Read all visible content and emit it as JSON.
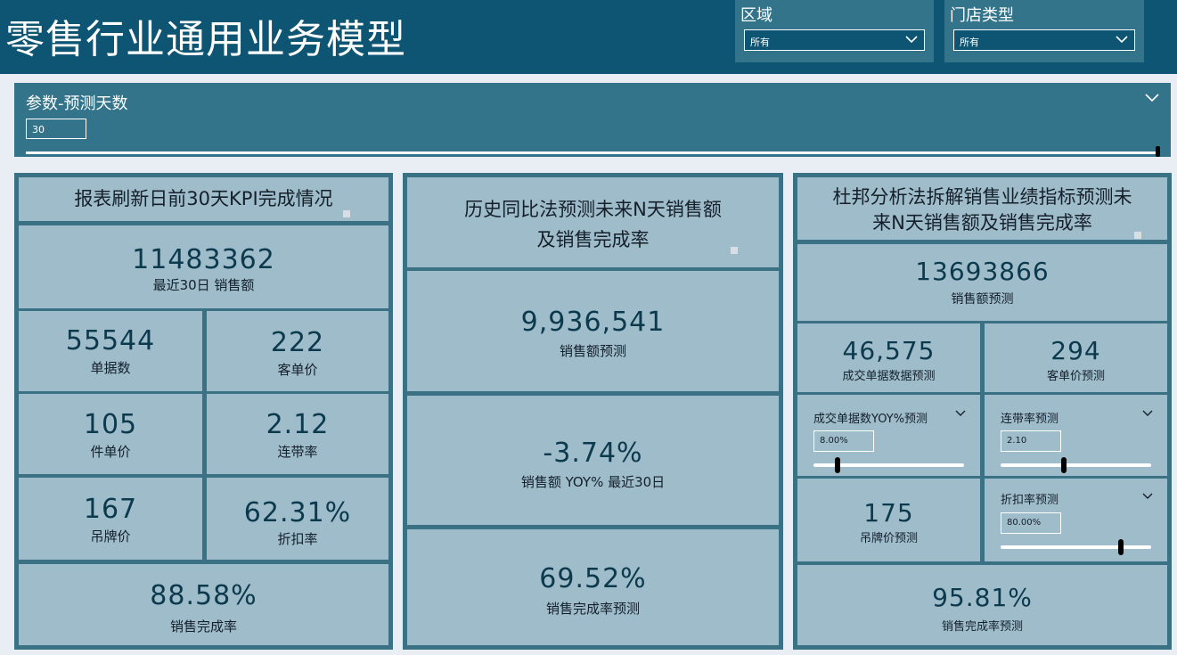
{
  "header": {
    "title": "零售行业通用业务模型",
    "region": {
      "label": "区域",
      "value": "所有"
    },
    "store_type": {
      "label": "门店类型",
      "value": "所有"
    }
  },
  "parameter": {
    "label": "参数-预测天数",
    "value": "30",
    "slider_fraction": 1.0
  },
  "left_panel": {
    "title": "报表刷新日前30天KPI完成情况",
    "sales": {
      "value": "11483362",
      "label": "最近30日 销售额"
    },
    "orders": {
      "value": "55544",
      "label": "单据数"
    },
    "avg_order": {
      "value": "222",
      "label": "客单价"
    },
    "unit_price": {
      "value": "105",
      "label": "件单价"
    },
    "attach_rate": {
      "value": "2.12",
      "label": "连带率"
    },
    "tag_price": {
      "value": "167",
      "label": "吊牌价"
    },
    "discount": {
      "value": "62.31%",
      "label": "折扣率"
    },
    "completion": {
      "value": "88.58%",
      "label": "销售完成率"
    }
  },
  "middle_panel": {
    "title_line1": "历史同比法预测未来N天销售额",
    "title_line2": "及销售完成率",
    "forecast_sales": {
      "value": "9,936,541",
      "label": "销售额预测"
    },
    "yoy": {
      "value": "-3.74%",
      "label": "销售额 YOY% 最近30日"
    },
    "forecast_completion": {
      "value": "69.52%",
      "label": "销售完成率预测"
    }
  },
  "right_panel": {
    "title_line1": "杜邦分析法拆解销售业绩指标预测未",
    "title_line2": "来N天销售额及销售完成率",
    "forecast_sales": {
      "value": "13693866",
      "label": "销售额预测"
    },
    "forecast_orders": {
      "value": "46,575",
      "label": "成交单据数据预测"
    },
    "forecast_avg_order": {
      "value": "294",
      "label": "客单价预测"
    },
    "orders_yoy_slicer": {
      "label": "成交单据数YOY%预测",
      "value": "8.00%",
      "slider_fraction": 0.16
    },
    "attach_rate_slicer": {
      "label": "连带率预测",
      "value": "2.10",
      "slider_fraction": 0.42
    },
    "forecast_tag_price": {
      "value": "175",
      "label": "吊牌价预测"
    },
    "discount_slicer": {
      "label": "折扣率预测",
      "value": "80.00%",
      "slider_fraction": 0.8
    },
    "forecast_completion": {
      "value": "95.81%",
      "label": "销售完成率预测"
    }
  },
  "icons": [
    "chevron-down-icon"
  ],
  "colors": {
    "header_bg": "#0d5572",
    "slicer_bg": "#33748b",
    "card_bg": "#9fbccb",
    "card_border": "#3b7185",
    "value_text": "#0c3a4d"
  }
}
